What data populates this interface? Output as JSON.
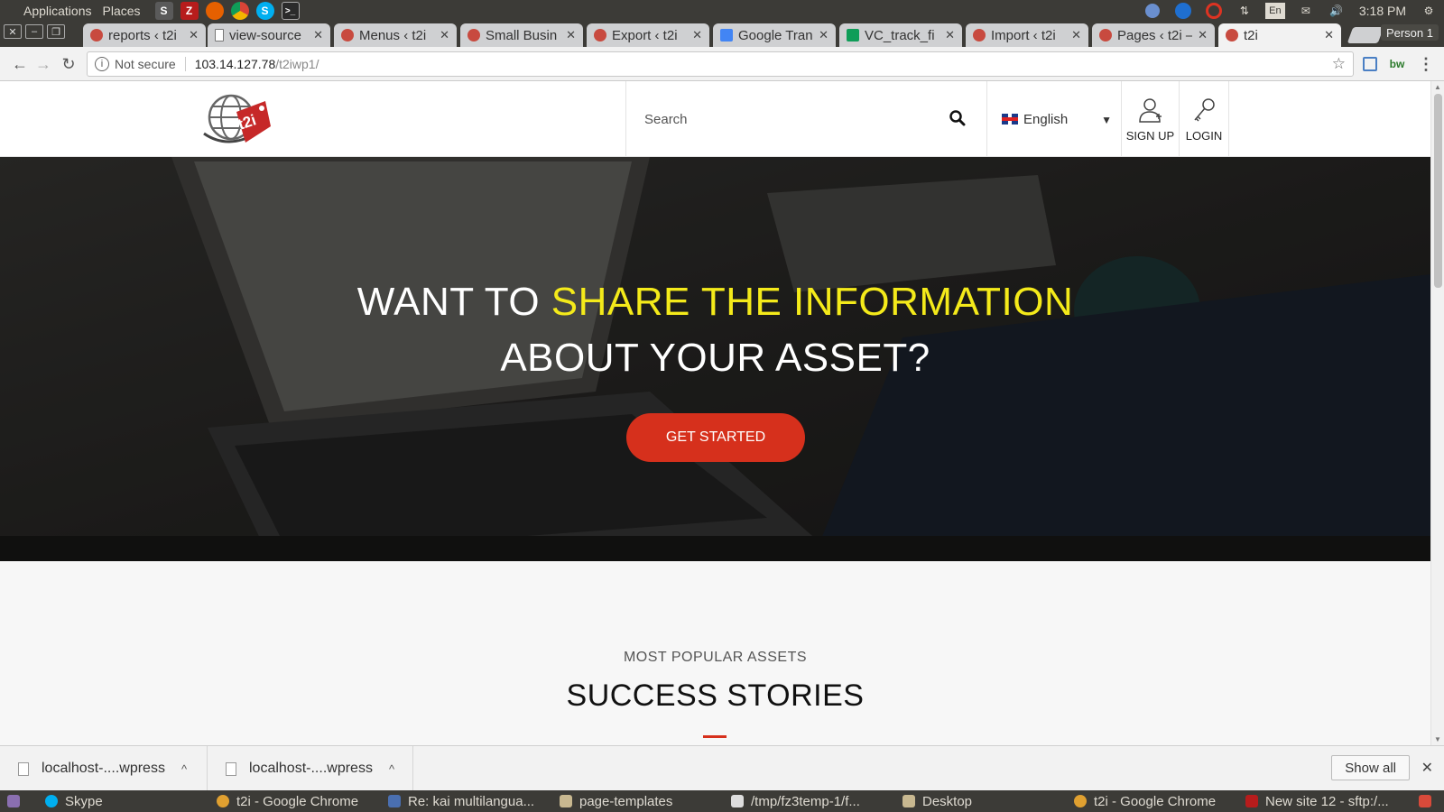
{
  "system": {
    "menu": [
      "Applications",
      "Places"
    ],
    "time": "3:18 PM",
    "keyboard": "En"
  },
  "browser": {
    "tabs": [
      {
        "title": "reports ‹ t2i"
      },
      {
        "title": "view-source"
      },
      {
        "title": "Menus ‹ t2i"
      },
      {
        "title": "Small Busin"
      },
      {
        "title": "Export ‹ t2i"
      },
      {
        "title": "Google Tran"
      },
      {
        "title": "VC_track_fi"
      },
      {
        "title": "Import ‹ t2i"
      },
      {
        "title": "Pages ‹ t2i –"
      },
      {
        "title": "t2i"
      }
    ],
    "profile": "Person 1",
    "security_label": "Not secure",
    "url_host": "103.14.127.78",
    "url_path": "/t2iwp1/"
  },
  "site": {
    "logo_text": "t2i",
    "search_placeholder": "Search",
    "language": "English",
    "signup_label": "SIGN UP",
    "login_label": "LOGIN",
    "hero_line1_plain": "WANT TO ",
    "hero_line1_highlight": "SHARE THE INFORMATION",
    "hero_line2": "ABOUT YOUR ASSET?",
    "cta_label": "GET STARTED",
    "section_kicker": "MOST POPULAR ASSETS",
    "section_title": "SUCCESS STORIES",
    "colors": {
      "accent": "#d6301c",
      "highlight": "#f4ea1a"
    }
  },
  "downloads": {
    "items": [
      {
        "name": "localhost-....wpress"
      },
      {
        "name": "localhost-....wpress"
      }
    ],
    "show_all": "Show all"
  },
  "taskbar": {
    "items": [
      {
        "label": "Skype"
      },
      {
        "label": "t2i - Google Chrome"
      },
      {
        "label": "Re: kai multilangua..."
      },
      {
        "label": "page-templates"
      },
      {
        "label": "/tmp/fz3temp-1/f..."
      },
      {
        "label": "Desktop"
      },
      {
        "label": "t2i - Google Chrome"
      },
      {
        "label": "New site 12 - sftp:/..."
      }
    ]
  }
}
